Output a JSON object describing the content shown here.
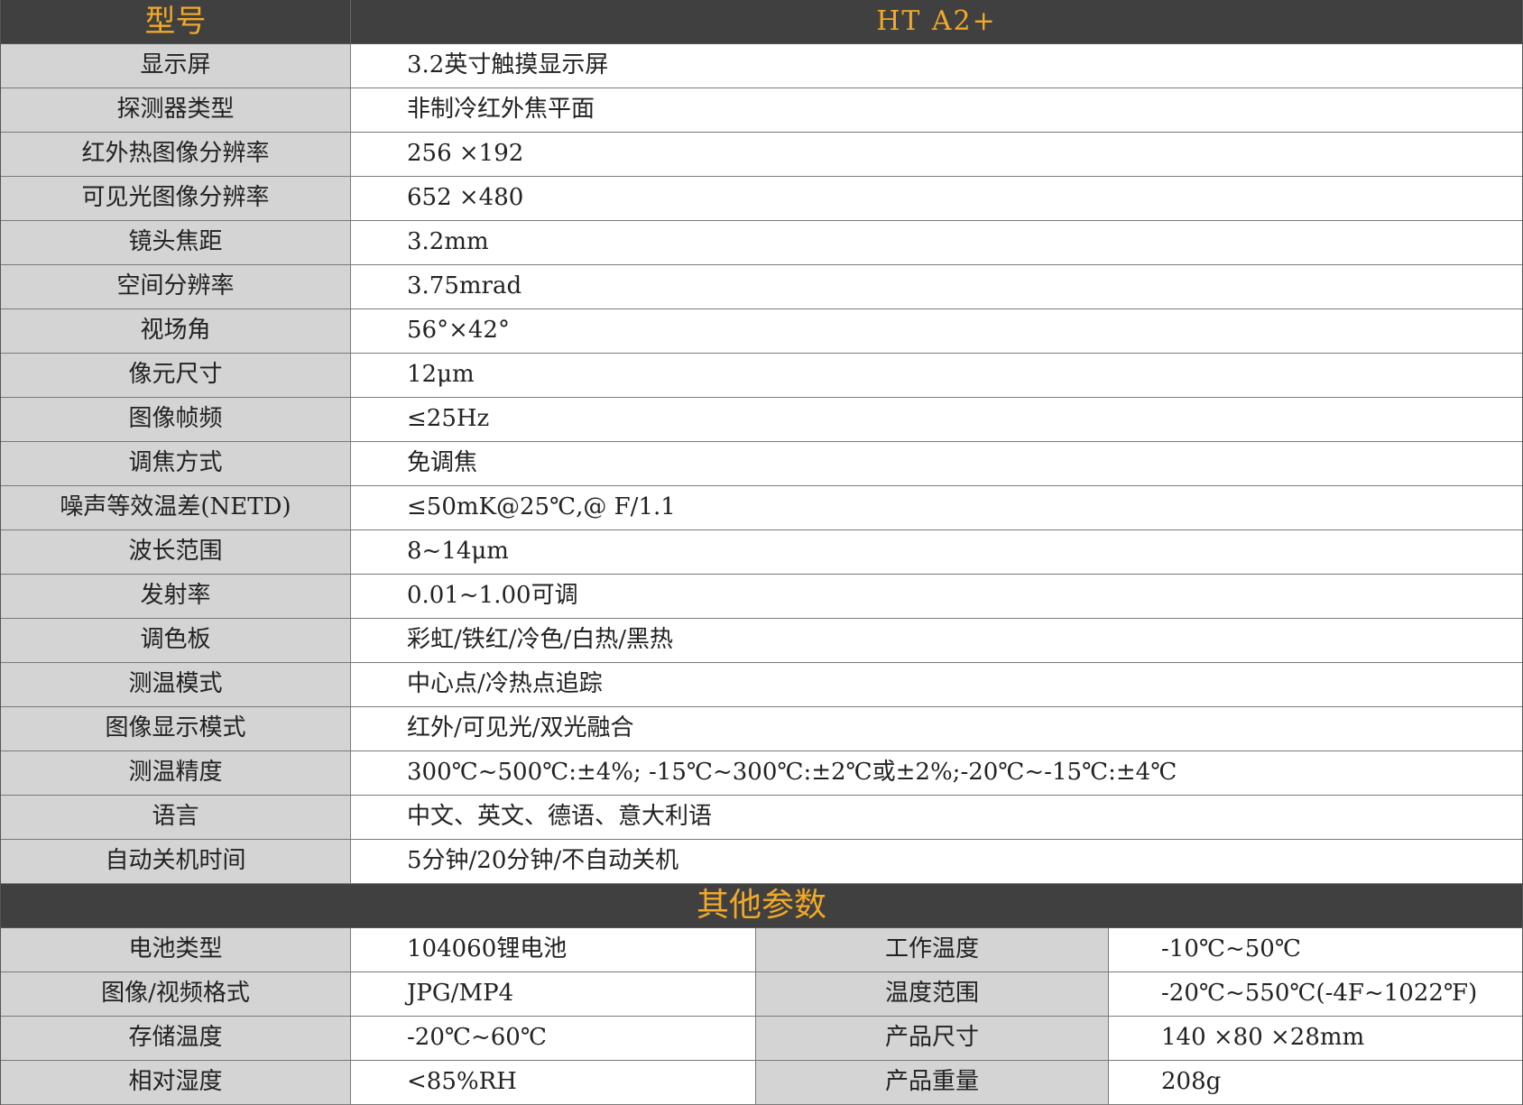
{
  "header": {
    "model_label": "型号",
    "model_value": "HT A2+"
  },
  "specs": [
    {
      "label": "显示屏",
      "value": "3.2英寸触摸显示屏"
    },
    {
      "label": "探测器类型",
      "value": "非制冷红外焦平面"
    },
    {
      "label": "红外热图像分辨率",
      "value": "256 ×192"
    },
    {
      "label": "可见光图像分辨率",
      "value": "652 ×480"
    },
    {
      "label": "镜头焦距",
      "value": "3.2mm"
    },
    {
      "label": "空间分辨率",
      "value": "3.75mrad"
    },
    {
      "label": "视场角",
      "value": "56°×42°"
    },
    {
      "label": "像元尺寸",
      "value": "12μm"
    },
    {
      "label": "图像帧频",
      "value": "≤25Hz"
    },
    {
      "label": "调焦方式",
      "value": "免调焦"
    },
    {
      "label": "噪声等效温差(NETD)",
      "value": "≤50mK@25℃,@ F/1.1"
    },
    {
      "label": "波长范围",
      "value": "8~14μm"
    },
    {
      "label": "发射率",
      "value": "0.01~1.00可调"
    },
    {
      "label": "调色板",
      "value": "彩虹/铁红/冷色/白热/黑热"
    },
    {
      "label": "测温模式",
      "value": "中心点/冷热点追踪"
    },
    {
      "label": "图像显示模式",
      "value": "红外/可见光/双光融合"
    },
    {
      "label": "测温精度",
      "value": "300℃~500℃:±4%; -15℃~300℃:±2℃或±2%;-20℃~-15℃:±4℃"
    },
    {
      "label": "语言",
      "value": "中文、英文、德语、意大利语"
    },
    {
      "label": "自动关机时间",
      "value": "5分钟/20分钟/不自动关机"
    }
  ],
  "other": {
    "title": "其他参数",
    "rows": [
      {
        "k1": "电池类型",
        "v1": "104060锂电池",
        "k2": "工作温度",
        "v2": "-10℃~50℃"
      },
      {
        "k1": "图像/视频格式",
        "v1": "JPG/MP4",
        "k2": "温度范围",
        "v2": "-20℃~550℃(-4F~1022℉)"
      },
      {
        "k1": "存储温度",
        "v1": "-20℃~60℃",
        "k2": "产品尺寸",
        "v2": "140 ×80 ×28mm"
      },
      {
        "k1": "相对湿度",
        "v1": "<85%RH",
        "k2": "产品重量",
        "v2": "208g"
      }
    ]
  }
}
